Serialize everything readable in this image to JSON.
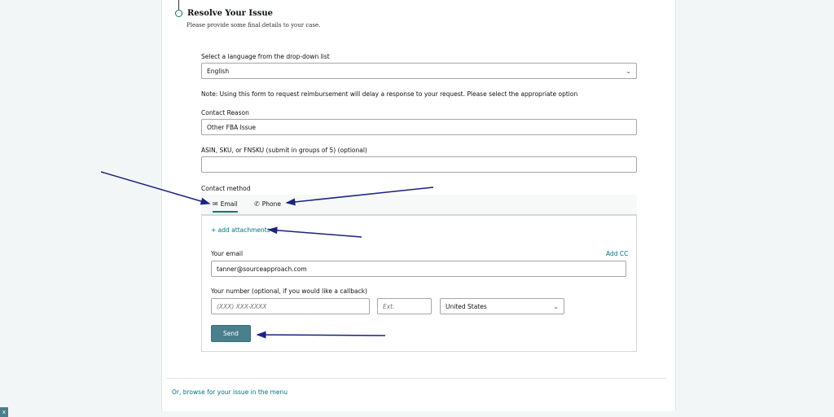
{
  "step": {
    "title": "Resolve Your Issue",
    "subtitle": "Please provide some final details to your case."
  },
  "language": {
    "label": "Select a language from the drop-down list",
    "value": "English"
  },
  "note": "Note: Using this form to request reimbursement will delay a response to your request. Please select the appropriate option",
  "contact_reason": {
    "label": "Contact Reason",
    "value": "Other FBA Issue"
  },
  "asin": {
    "label": "ASIN, SKU, or FNSKU (submit in groups of 5) (optional)",
    "value": ""
  },
  "contact_method": {
    "label": "Contact method",
    "tabs": [
      {
        "label": "Email",
        "icon": "envelope-icon",
        "active": true
      },
      {
        "label": "Phone",
        "icon": "phone-icon",
        "active": false
      }
    ]
  },
  "form": {
    "add_attachments": "+ add attachments",
    "email_label": "Your email",
    "add_cc": "Add CC",
    "email_value": "tanner@sourceapproach.com",
    "number_label": "Your number (optional, if you would like a callback)",
    "phone_placeholder": "(XXX) XXX-XXXX",
    "ext_placeholder": "Ext.",
    "country_value": "United States",
    "send_label": "Send"
  },
  "footer_link": "Or, browse for your issue in the menu",
  "close_label": "x",
  "colors": {
    "accent": "#067d62",
    "link": "#007185",
    "send_button": "#4a7f8c",
    "annotation_arrow": "#1a237e"
  }
}
